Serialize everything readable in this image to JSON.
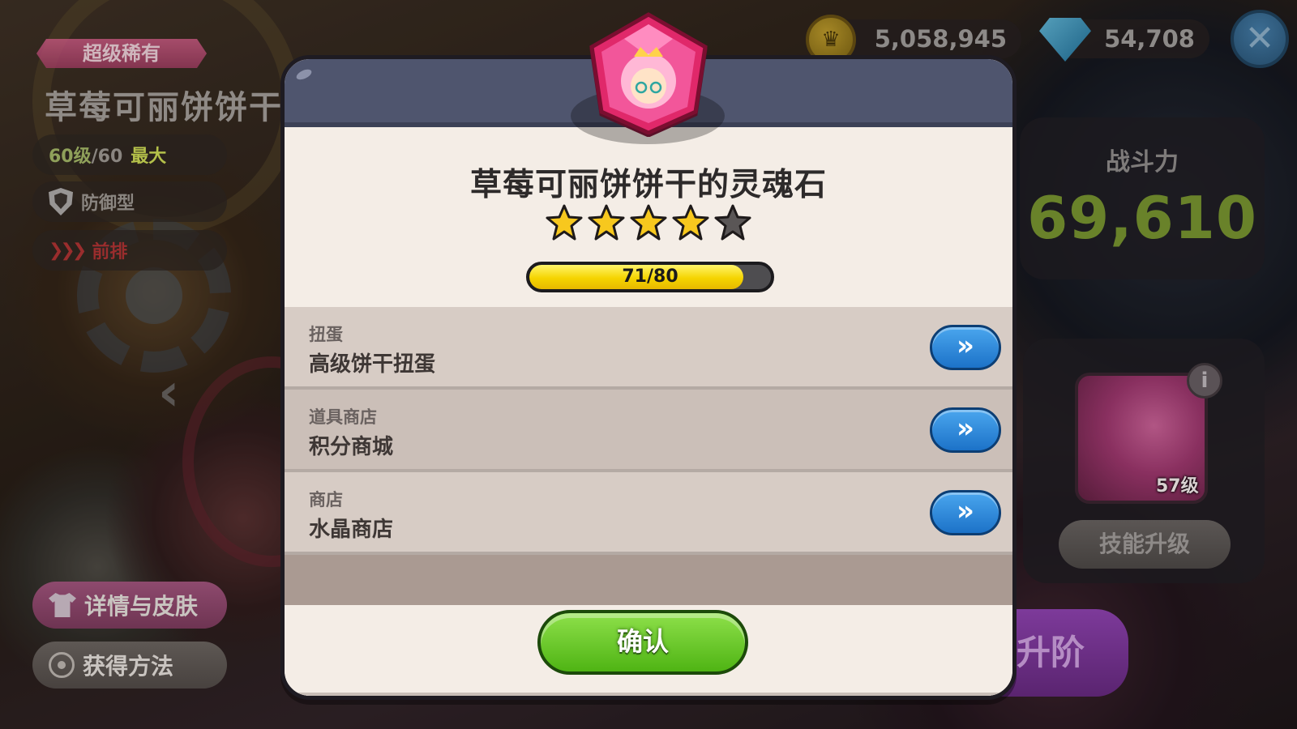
{
  "left_panel": {
    "rarity": "超级稀有",
    "cookie_name": "草莓可丽饼饼干",
    "level_current": "60级",
    "level_separator": "/60",
    "level_max": "最大",
    "role": "防御型",
    "position": "前排",
    "details_button": "详情与皮肤",
    "acquire_button": "获得方法"
  },
  "top_bar": {
    "coins": "5,058,945",
    "crystals": "54,708",
    "close_symbol": "✕"
  },
  "right_panel": {
    "power_label": "战斗力",
    "power_value": "69,610",
    "skill_level": "57级",
    "skill_upgrade_button": "技能升级",
    "advance_button": "升阶",
    "info_symbol": "i"
  },
  "modal": {
    "title": "草莓可丽饼饼干的灵魂石",
    "stars_filled": 4,
    "stars_total": 5,
    "progress_current": 71,
    "progress_max": 80,
    "progress_text": "71/80",
    "sources": [
      {
        "category": "扭蛋",
        "name": "高级饼干扭蛋",
        "go_symbol": "»"
      },
      {
        "category": "道具商店",
        "name": "积分商城",
        "go_symbol": "»"
      },
      {
        "category": "商店",
        "name": "水晶商店",
        "go_symbol": "»"
      }
    ],
    "confirm_button": "确认"
  },
  "colors": {
    "star_filled": "#f7c81e",
    "star_empty": "#5a5656",
    "soulstone": "#e0286a",
    "confirm_green": "#5fc41e",
    "go_blue": "#2a86dc"
  },
  "icons": {
    "coin": "crown-coin-icon",
    "crystal": "crystal-gem-icon",
    "close": "close-icon",
    "shield": "shield-icon",
    "front_row": "chevrons-icon",
    "back": "chevron-left-icon",
    "skin": "shirt-icon",
    "acquire": "eye-icon",
    "info": "info-icon",
    "soulstone": "soulstone-icon",
    "go": "double-chevron-right-icon"
  }
}
